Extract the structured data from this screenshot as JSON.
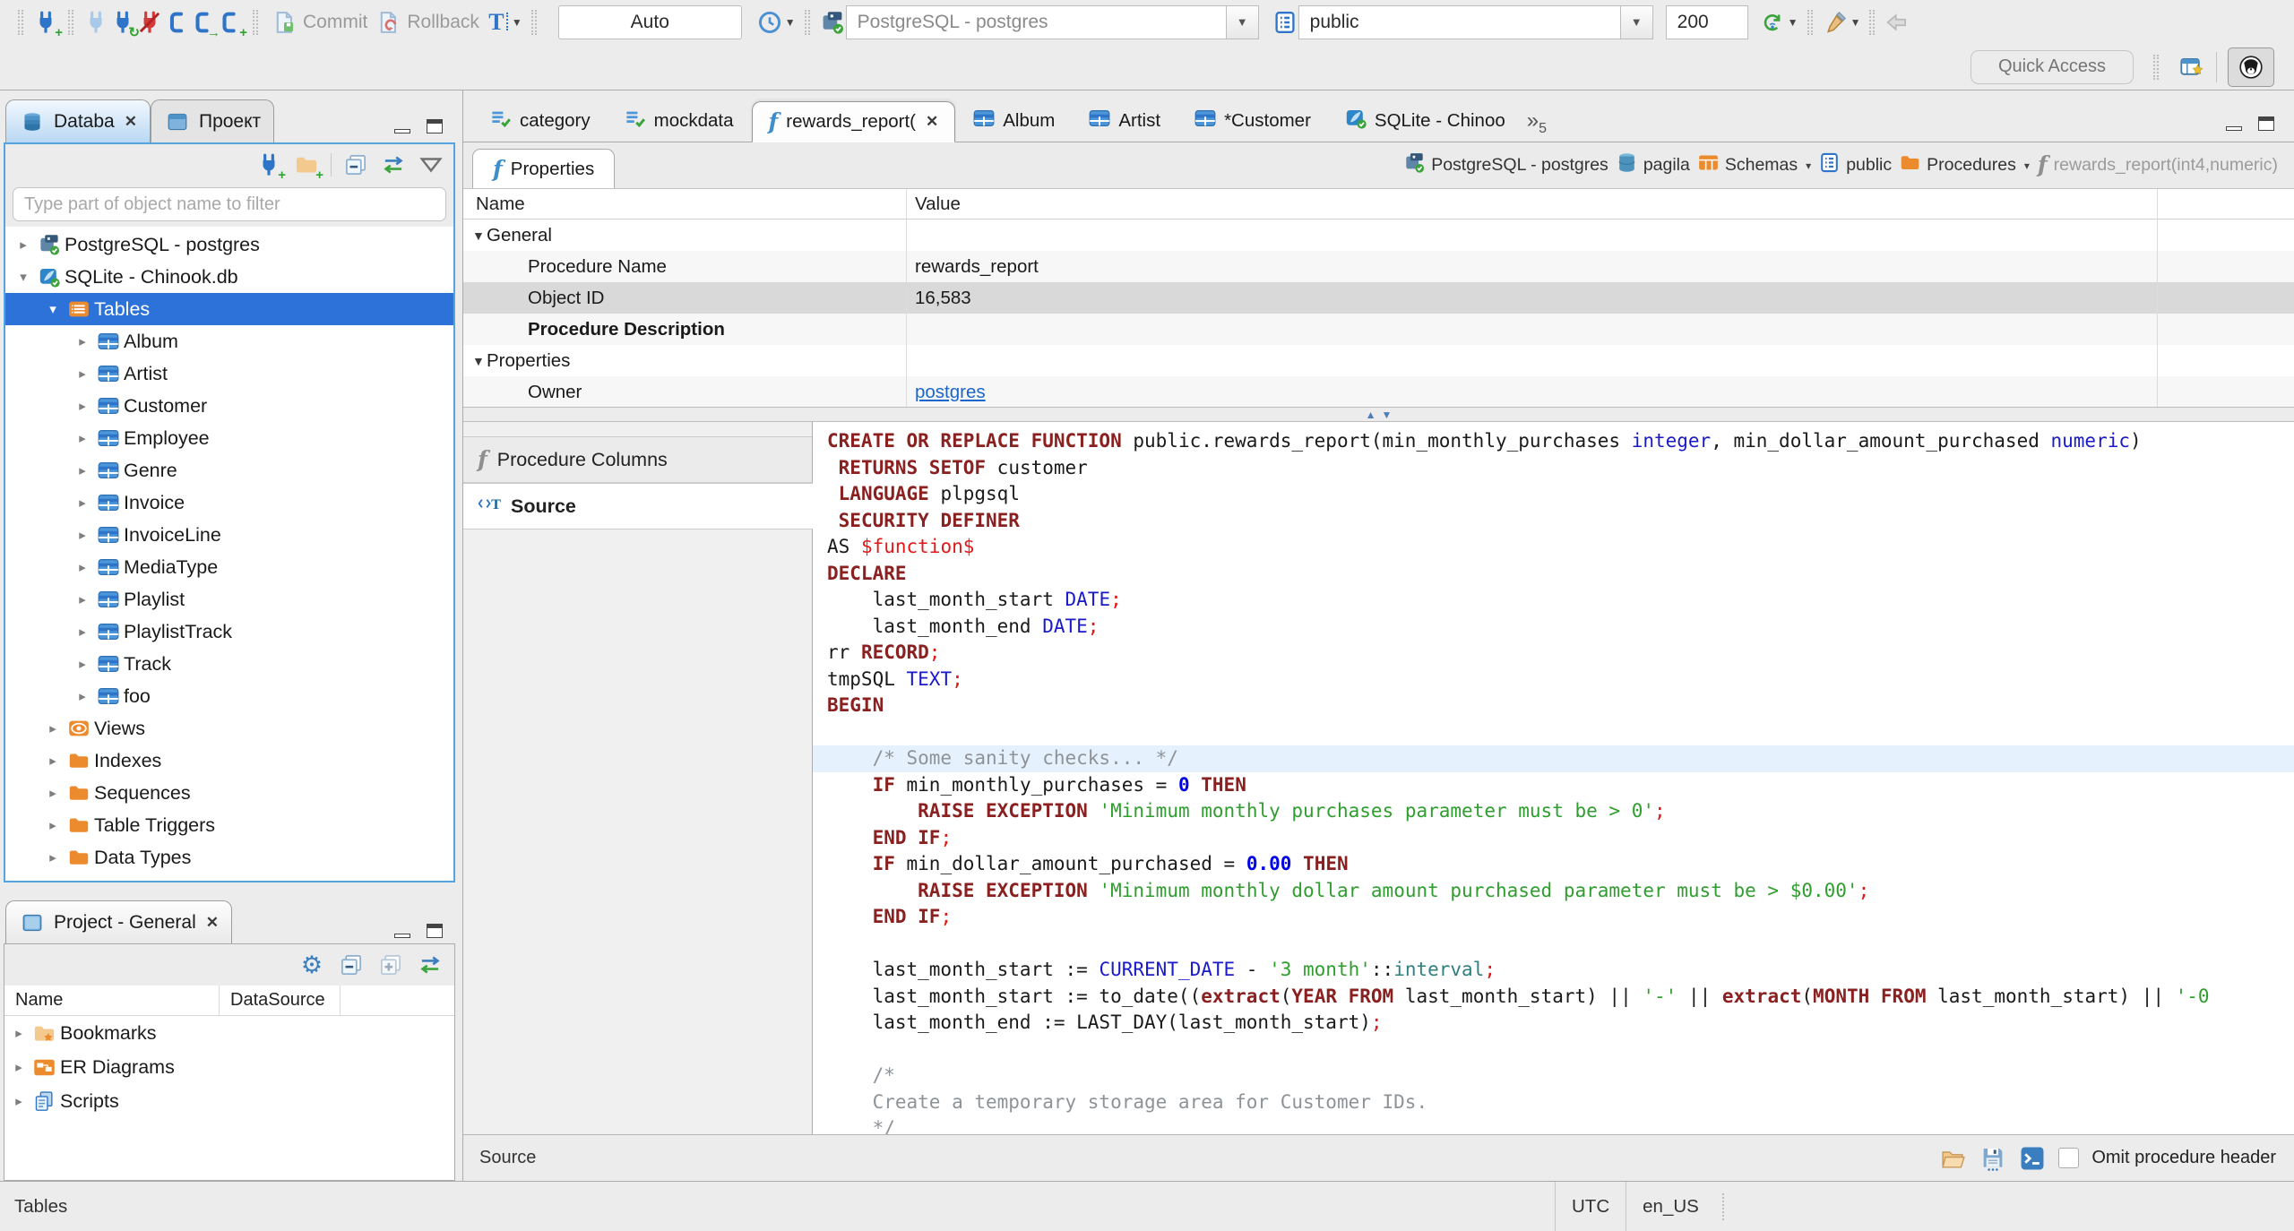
{
  "toolbar": {
    "commit_label": "Commit",
    "rollback_label": "Rollback",
    "auto_label": "Auto",
    "connection_value": "PostgreSQL - postgres",
    "schema_value": "public",
    "fetch_size_value": "200",
    "quick_access_placeholder": "Quick Access"
  },
  "navigator": {
    "tab_database": "Databa",
    "tab_project": "Проект",
    "filter_placeholder": "Type part of object name to filter",
    "tree": [
      {
        "label": "PostgreSQL - postgres",
        "level": 0,
        "icon": "pg",
        "twisty": "right"
      },
      {
        "label": "SQLite - Chinook.db",
        "level": 0,
        "icon": "sqlite",
        "twisty": "down"
      },
      {
        "label": "Tables",
        "level": 1,
        "icon": "tables",
        "twisty": "down",
        "selected": true
      },
      {
        "label": "Album",
        "level": 2,
        "icon": "table",
        "twisty": "right"
      },
      {
        "label": "Artist",
        "level": 2,
        "icon": "table",
        "twisty": "right"
      },
      {
        "label": "Customer",
        "level": 2,
        "icon": "table",
        "twisty": "right"
      },
      {
        "label": "Employee",
        "level": 2,
        "icon": "table",
        "twisty": "right"
      },
      {
        "label": "Genre",
        "level": 2,
        "icon": "table",
        "twisty": "right"
      },
      {
        "label": "Invoice",
        "level": 2,
        "icon": "table",
        "twisty": "right"
      },
      {
        "label": "InvoiceLine",
        "level": 2,
        "icon": "table",
        "twisty": "right"
      },
      {
        "label": "MediaType",
        "level": 2,
        "icon": "table",
        "twisty": "right"
      },
      {
        "label": "Playlist",
        "level": 2,
        "icon": "table",
        "twisty": "right"
      },
      {
        "label": "PlaylistTrack",
        "level": 2,
        "icon": "table",
        "twisty": "right"
      },
      {
        "label": "Track",
        "level": 2,
        "icon": "table",
        "twisty": "right"
      },
      {
        "label": "foo",
        "level": 2,
        "icon": "table",
        "twisty": "right"
      },
      {
        "label": "Views",
        "level": 1,
        "icon": "views",
        "twisty": "right"
      },
      {
        "label": "Indexes",
        "level": 1,
        "icon": "folder",
        "twisty": "right"
      },
      {
        "label": "Sequences",
        "level": 1,
        "icon": "folder",
        "twisty": "right"
      },
      {
        "label": "Table Triggers",
        "level": 1,
        "icon": "folder",
        "twisty": "right"
      },
      {
        "label": "Data Types",
        "level": 1,
        "icon": "folder",
        "twisty": "right"
      }
    ]
  },
  "project_panel": {
    "title": "Project - General",
    "columns": [
      "Name",
      "DataSource"
    ],
    "items": [
      {
        "label": "Bookmarks",
        "icon": "bookmarks"
      },
      {
        "label": "ER Diagrams",
        "icon": "erd"
      },
      {
        "label": "Scripts",
        "icon": "scripts"
      }
    ]
  },
  "editor": {
    "tabs": [
      {
        "label": "category",
        "icon": "script"
      },
      {
        "label": "mockdata",
        "icon": "script"
      },
      {
        "label": "rewards_report(",
        "icon": "func",
        "active": true,
        "closable": true
      },
      {
        "label": "Album",
        "icon": "table"
      },
      {
        "label": "Artist",
        "icon": "table"
      },
      {
        "label": "*Customer",
        "icon": "table"
      },
      {
        "label": "SQLite - Chinoo",
        "icon": "sqlite"
      }
    ],
    "overflow_count": "5",
    "properties_tab": "Properties",
    "breadcrumb": [
      {
        "label": "PostgreSQL - postgres",
        "icon": "pg"
      },
      {
        "label": "pagila",
        "icon": "db"
      },
      {
        "label": "Schemas",
        "icon": "schemas",
        "dropdown": true
      },
      {
        "label": "public",
        "icon": "page"
      },
      {
        "label": "Procedures",
        "icon": "folder",
        "dropdown": true
      },
      {
        "label": "rewards_report(int4,numeric)",
        "icon": "funcgray",
        "muted": true
      }
    ],
    "grid": {
      "name_header": "Name",
      "value_header": "Value",
      "rows": [
        {
          "name": "General",
          "value": "",
          "group": true
        },
        {
          "name": "Procedure Name",
          "value": "rewards_report",
          "indent": true
        },
        {
          "name": "Object ID",
          "value": "16,583",
          "indent": true,
          "selected": true
        },
        {
          "name": "Procedure Description",
          "value": "",
          "indent": true,
          "bold": true
        },
        {
          "name": "Properties",
          "value": "",
          "group": true
        },
        {
          "name": "Owner",
          "value": "postgres",
          "indent": true,
          "link": true
        }
      ]
    },
    "side_tabs": [
      {
        "label": "Procedure Columns",
        "icon": "funcgray"
      },
      {
        "label": "Source",
        "icon": "source",
        "active": true
      }
    ],
    "source_bar": {
      "label": "Source",
      "omit_checkbox_label": "Omit procedure header"
    }
  },
  "code": {
    "highlight_note": "line 13 has current-line highlight",
    "lines": [
      {
        "toks": [
          [
            "k",
            "CREATE OR REPLACE FUNCTION"
          ],
          [
            "d",
            " public.rewards_report(min_monthly_purchases "
          ],
          [
            "t",
            "integer"
          ],
          [
            "d",
            ", min_dollar_amount_purchased "
          ],
          [
            "t",
            "numeric"
          ],
          [
            "d",
            ")"
          ]
        ]
      },
      {
        "toks": [
          [
            "d",
            " "
          ],
          [
            "k",
            "RETURNS SETOF"
          ],
          [
            "d",
            " customer"
          ]
        ]
      },
      {
        "toks": [
          [
            "d",
            " "
          ],
          [
            "k",
            "LANGUAGE"
          ],
          [
            "d",
            " plpgsql"
          ]
        ]
      },
      {
        "toks": [
          [
            "d",
            " "
          ],
          [
            "k",
            "SECURITY DEFINER"
          ]
        ]
      },
      {
        "toks": [
          [
            "d",
            "AS "
          ],
          [
            "p",
            "$function$"
          ]
        ]
      },
      {
        "toks": [
          [
            "k",
            "DECLARE"
          ]
        ]
      },
      {
        "toks": [
          [
            "d",
            "    last_month_start "
          ],
          [
            "t",
            "DATE"
          ],
          [
            "p",
            ";"
          ]
        ]
      },
      {
        "toks": [
          [
            "d",
            "    last_month_end "
          ],
          [
            "t",
            "DATE"
          ],
          [
            "p",
            ";"
          ]
        ]
      },
      {
        "toks": [
          [
            "d",
            "rr "
          ],
          [
            "k",
            "RECORD"
          ],
          [
            "p",
            ";"
          ]
        ]
      },
      {
        "toks": [
          [
            "d",
            "tmpSQL "
          ],
          [
            "t",
            "TEXT"
          ],
          [
            "p",
            ";"
          ]
        ]
      },
      {
        "toks": [
          [
            "k",
            "BEGIN"
          ]
        ]
      },
      {
        "toks": []
      },
      {
        "hl": true,
        "toks": [
          [
            "c",
            "    /* Some sanity checks... */"
          ]
        ]
      },
      {
        "toks": [
          [
            "d",
            "    "
          ],
          [
            "k",
            "IF"
          ],
          [
            "d",
            " min_monthly_purchases = "
          ],
          [
            "n",
            "0"
          ],
          [
            "d",
            " "
          ],
          [
            "k",
            "THEN"
          ]
        ]
      },
      {
        "toks": [
          [
            "d",
            "        "
          ],
          [
            "k",
            "RAISE EXCEPTION"
          ],
          [
            "d",
            " "
          ],
          [
            "s",
            "'Minimum monthly purchases parameter must be > 0'"
          ],
          [
            "p",
            ";"
          ]
        ]
      },
      {
        "toks": [
          [
            "d",
            "    "
          ],
          [
            "k",
            "END IF"
          ],
          [
            "p",
            ";"
          ]
        ]
      },
      {
        "toks": [
          [
            "d",
            "    "
          ],
          [
            "k",
            "IF"
          ],
          [
            "d",
            " min_dollar_amount_purchased = "
          ],
          [
            "n",
            "0.00"
          ],
          [
            "d",
            " "
          ],
          [
            "k",
            "THEN"
          ]
        ]
      },
      {
        "toks": [
          [
            "d",
            "        "
          ],
          [
            "k",
            "RAISE EXCEPTION"
          ],
          [
            "d",
            " "
          ],
          [
            "s",
            "'Minimum monthly dollar amount purchased parameter must be > $0.00'"
          ],
          [
            "p",
            ";"
          ]
        ]
      },
      {
        "toks": [
          [
            "d",
            "    "
          ],
          [
            "k",
            "END IF"
          ],
          [
            "p",
            ";"
          ]
        ]
      },
      {
        "toks": []
      },
      {
        "toks": [
          [
            "d",
            "    last_month_start := "
          ],
          [
            "b",
            "CURRENT_DATE"
          ],
          [
            "d",
            " - "
          ],
          [
            "s",
            "'3 month'"
          ],
          [
            "d",
            "::"
          ],
          [
            "i",
            "interval"
          ],
          [
            "p",
            ";"
          ]
        ]
      },
      {
        "toks": [
          [
            "d",
            "    last_month_start := to_date(("
          ],
          [
            "k",
            "extract"
          ],
          [
            "d",
            "("
          ],
          [
            "k",
            "YEAR FROM"
          ],
          [
            "d",
            " last_month_start) || "
          ],
          [
            "s",
            "'-'"
          ],
          [
            "d",
            " || "
          ],
          [
            "k",
            "extract"
          ],
          [
            "d",
            "("
          ],
          [
            "k",
            "MONTH FROM"
          ],
          [
            "d",
            " last_month_start) || "
          ],
          [
            "s",
            "'-0"
          ]
        ]
      },
      {
        "toks": [
          [
            "d",
            "    last_month_end := LAST_DAY(last_month_start)"
          ],
          [
            "p",
            ";"
          ]
        ]
      },
      {
        "toks": []
      },
      {
        "toks": [
          [
            "c",
            "    /*"
          ]
        ]
      },
      {
        "toks": [
          [
            "c",
            "    Create a temporary storage area for Customer IDs."
          ]
        ]
      },
      {
        "toks": [
          [
            "c",
            "    */"
          ]
        ]
      }
    ]
  },
  "statusbar": {
    "left": "Tables",
    "timezone": "UTC",
    "locale": "en_US"
  },
  "colors": {
    "accent": "#2E74C8",
    "selection": "#2D72D9",
    "focus_border": "#56A4DF",
    "keyword": "#8B2020",
    "type": "#1A1AC8",
    "string": "#2E9E2E",
    "punct": "#E01818",
    "comment": "#8E9398",
    "link": "#1A66CC",
    "line_highlight": "#E5F1FC",
    "tree_folder": "#EC8B2E"
  }
}
